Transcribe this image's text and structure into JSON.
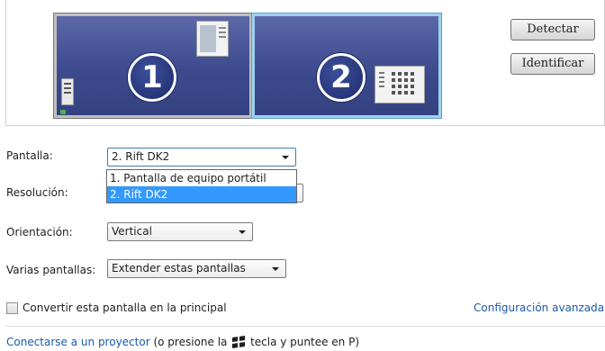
{
  "preview": {
    "monitors": [
      {
        "number": "1",
        "selected": false
      },
      {
        "number": "2",
        "selected": true
      }
    ],
    "detect_label": "Detectar",
    "identify_label": "Identificar"
  },
  "display": {
    "label": "Pantalla:",
    "value": "2. Rift DK2",
    "options": [
      "1. Pantalla de equipo portátil",
      "2. Rift DK2"
    ],
    "selected_option": "2. Rift DK2"
  },
  "resolution": {
    "label": "Resolución:"
  },
  "orientation": {
    "label": "Orientación:",
    "value": "Vertical"
  },
  "multiple_displays": {
    "label": "Varias pantallas:",
    "value": "Extender estas pantallas"
  },
  "primary_checkbox": {
    "label": "Convertir esta pantalla en la principal",
    "checked": false
  },
  "advanced_link": "Configuración avanzada",
  "projector": {
    "link": "Conectarse a un proyector",
    "text_before_icon": "(o presione la",
    "text_after_icon": "tecla y puntee en P)",
    "icon": "windows-logo-icon"
  },
  "colors": {
    "selection": "#3399ff",
    "link": "#1a5aa8",
    "monitor_fill": "#3c4a8e"
  }
}
